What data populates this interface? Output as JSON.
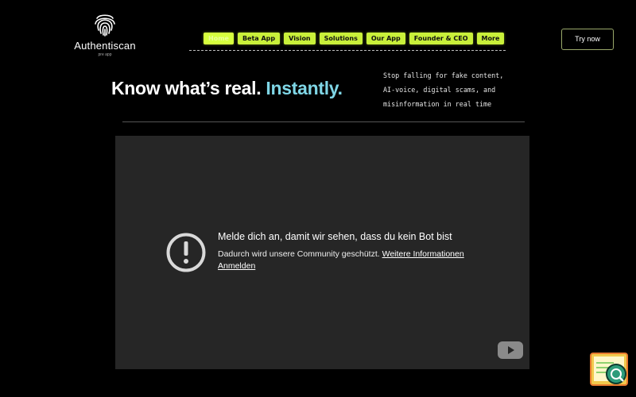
{
  "brand": {
    "name": "Authentiscan",
    "sub": "pre app"
  },
  "nav": {
    "items": [
      {
        "label": "Home"
      },
      {
        "label": "Beta App"
      },
      {
        "label": "Vision"
      },
      {
        "label": "Solutions"
      },
      {
        "label": "Our App"
      },
      {
        "label": "Founder & CEO"
      },
      {
        "label": "More"
      }
    ],
    "active_index": 0
  },
  "cta": {
    "label": "Try now"
  },
  "hero": {
    "headline": "Know what’s real.",
    "headline_accent": "Instantly.",
    "tagline_lines": [
      "Stop falling for fake content,",
      "AI-voice, digital scams, and",
      "misinformation in real time"
    ]
  },
  "video": {
    "title": "Melde dich an, damit wir sehen, dass du kein Bot bist",
    "message": "Dadurch wird unsere Community geschützt.",
    "more_info_link": "Weitere Informationen",
    "login_link": "Anmelden"
  },
  "colors": {
    "accent_green": "#c9f03a",
    "accent_cyan": "#7fd6e6",
    "background": "#000000",
    "video_bg": "#262626"
  },
  "icons": {
    "logo": "fingerprint-icon",
    "warning": "warning-circle-icon",
    "youtube": "youtube-play-icon",
    "widget": "chat-widget-icon"
  }
}
